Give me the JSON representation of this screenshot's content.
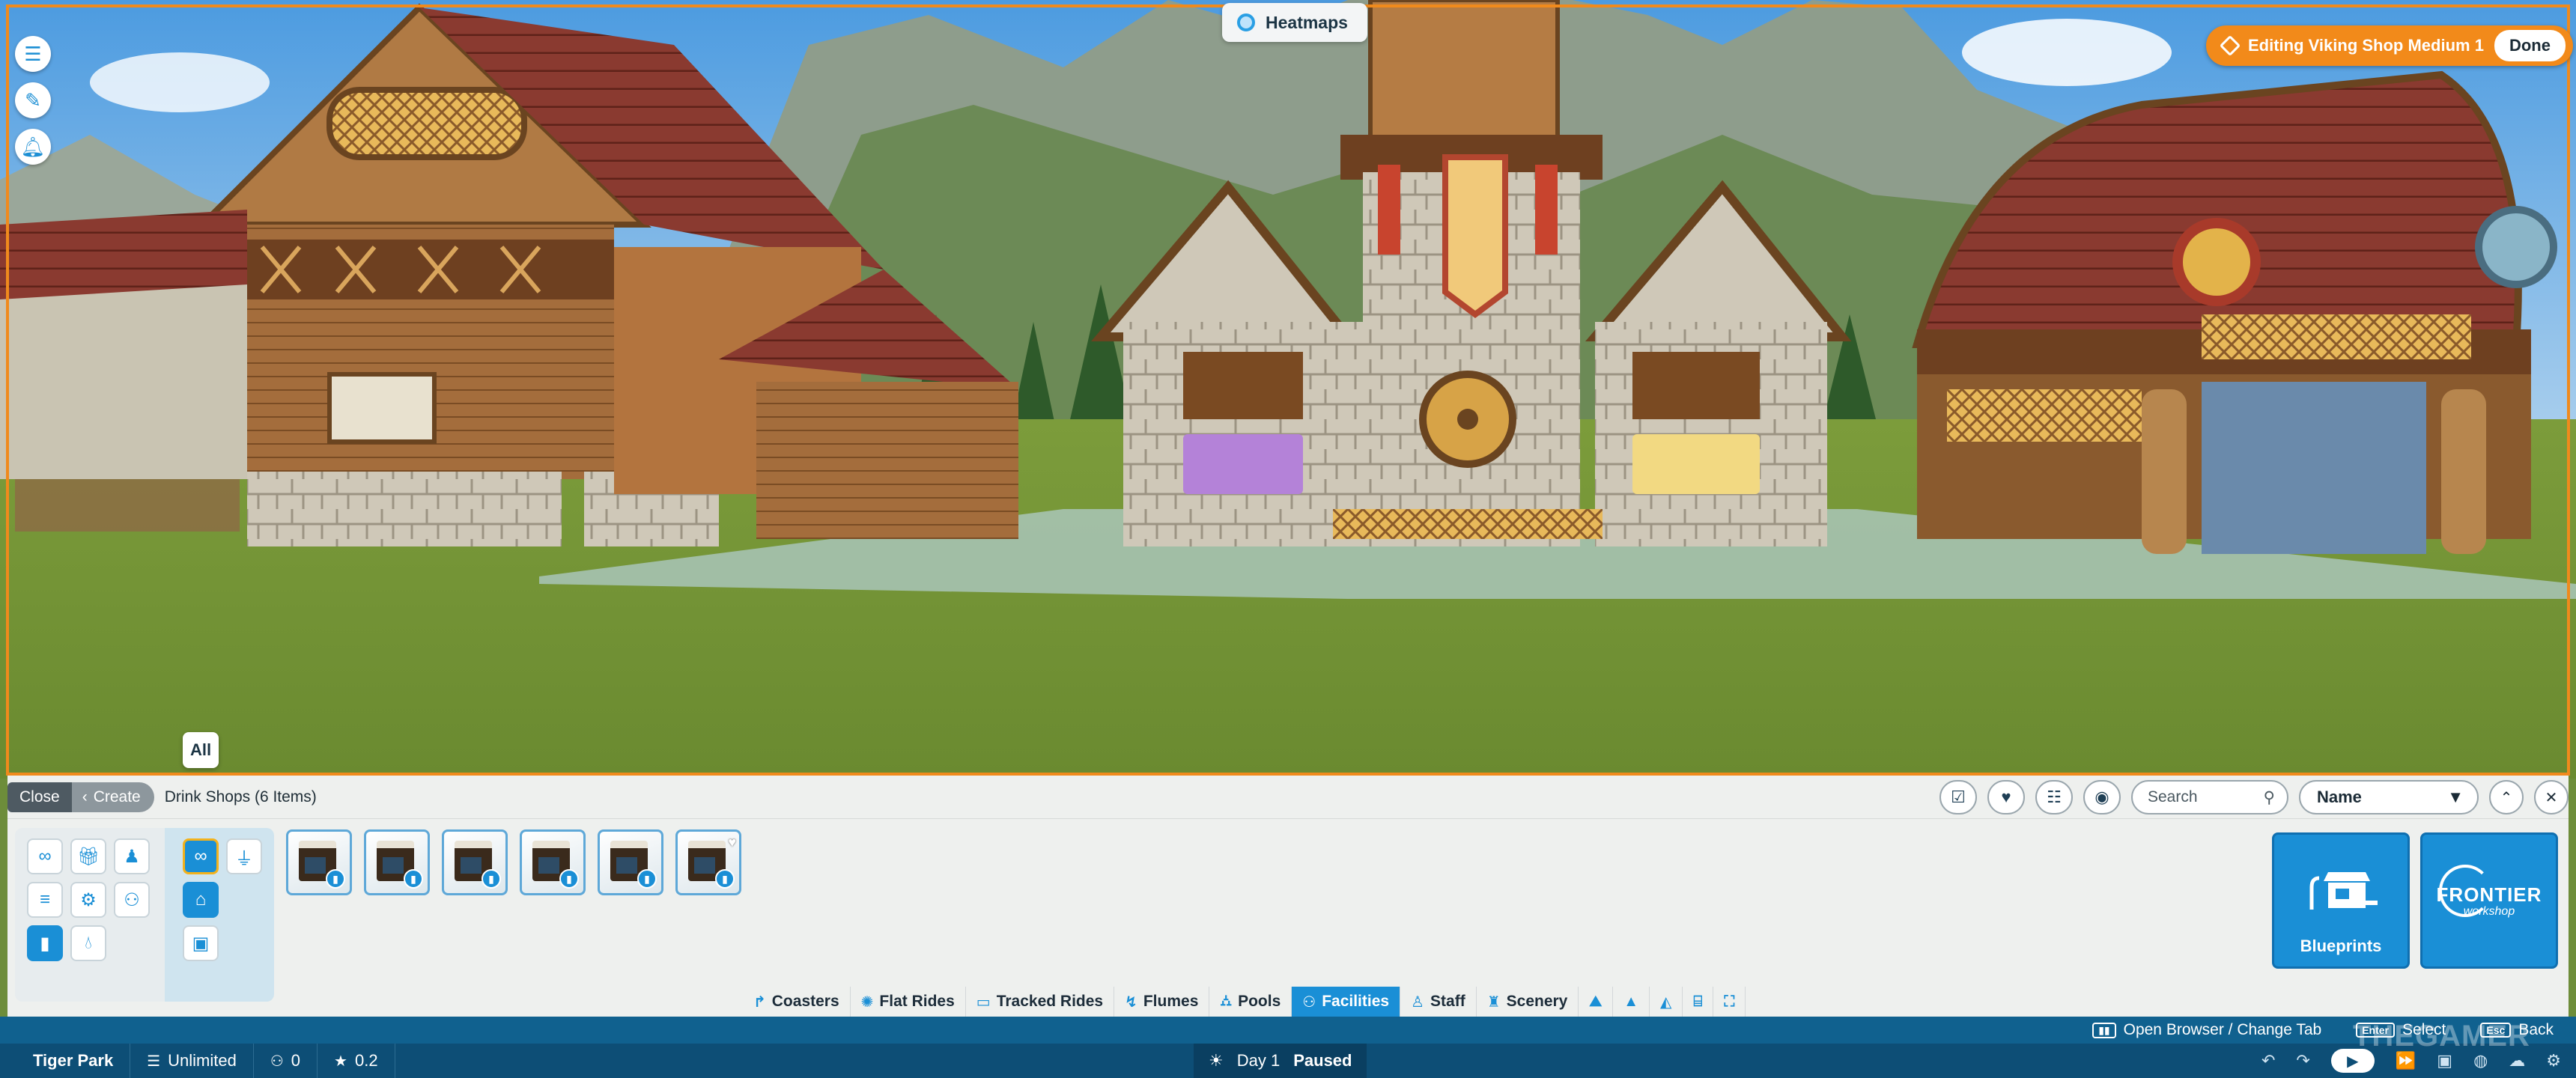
{
  "scene": {
    "heatmaps_label": "Heatmaps",
    "editing_label": "Editing Viking Shop Medium 1",
    "done_label": "Done",
    "side_tools": [
      "notes-icon",
      "build-tools-icon",
      "notifications-icon"
    ],
    "all_label": "All"
  },
  "browser": {
    "close_label": "Close",
    "create_label": "Create",
    "breadcrumb": "Drink Shops (6 Items)",
    "search_placeholder": "Search",
    "sort_value": "Name",
    "items": [
      {
        "name": "drink-shop-1",
        "favorited": false
      },
      {
        "name": "drink-shop-2",
        "favorited": false
      },
      {
        "name": "drink-shop-3",
        "favorited": false
      },
      {
        "name": "drink-shop-4",
        "favorited": false
      },
      {
        "name": "drink-shop-5",
        "favorited": false
      },
      {
        "name": "drink-shop-6",
        "favorited": true
      }
    ],
    "blueprints_label": "Blueprints",
    "frontier_line1": "FRONTIER",
    "frontier_line2": "workshop"
  },
  "tabs": [
    {
      "label": "Coasters",
      "icon": "coaster-icon"
    },
    {
      "label": "Flat Rides",
      "icon": "flat-ride-icon"
    },
    {
      "label": "Tracked Rides",
      "icon": "tracked-ride-icon"
    },
    {
      "label": "Flumes",
      "icon": "flume-icon"
    },
    {
      "label": "Pools",
      "icon": "pool-icon"
    },
    {
      "label": "Facilities",
      "icon": "facilities-icon",
      "active": true
    },
    {
      "label": "Staff",
      "icon": "staff-icon"
    },
    {
      "label": "Scenery",
      "icon": "scenery-icon"
    }
  ],
  "hints": {
    "open_browser": "Open Browser / Change Tab",
    "enter_key": "Enter",
    "select": "Select",
    "esc_key": "Esc",
    "back": "Back"
  },
  "status": {
    "park_name": "Tiger Park",
    "money": "Unlimited",
    "guests": "0",
    "rating": "0.2",
    "day": "Day 1",
    "paused": "Paused"
  },
  "colors": {
    "accent": "#1a8fd6",
    "edit_orange": "#f28a1a",
    "status_bar": "#0d4e76"
  },
  "watermark": "THEGAMER"
}
